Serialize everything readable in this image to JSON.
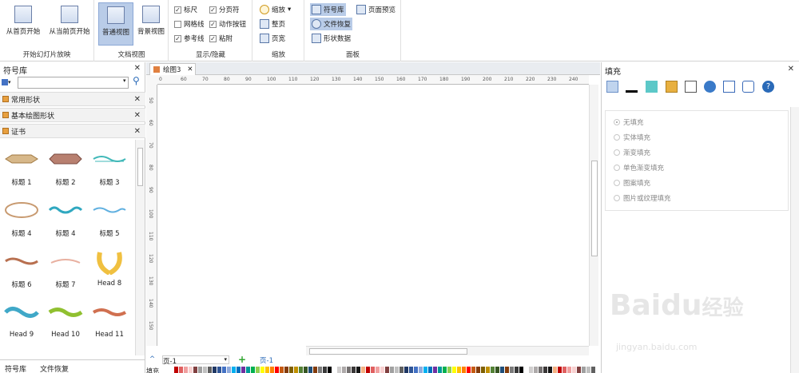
{
  "ribbon": {
    "groups": {
      "slideshow": {
        "label": "开始幻灯片放映",
        "from_first": "从首页开始",
        "from_current": "从当前页开始"
      },
      "docview": {
        "label": "文档视图",
        "normal": "普通视图",
        "background": "背景视图"
      },
      "showhide": {
        "label": "显示/隐藏",
        "ruler": "标尺",
        "pagebreak": "分页符",
        "grid": "网格线",
        "action": "动作按钮",
        "guides": "参考线",
        "glue": "粘附"
      },
      "zoom": {
        "label": "缩放",
        "zoom": "缩放",
        "fit_page": "整页",
        "page_width": "页宽"
      },
      "panels": {
        "label": "面板",
        "symbols": "符号库",
        "recovery": "文件恢复",
        "shape_data": "形状数据",
        "page_preview": "页面预览"
      }
    }
  },
  "left_panel": {
    "title": "符号库",
    "search_placeholder": "",
    "sections": [
      "常用形状",
      "基本绘图形状",
      "证书"
    ],
    "shapes": [
      {
        "label": "标题 1"
      },
      {
        "label": "标题 2"
      },
      {
        "label": "标题 3"
      },
      {
        "label": "标题 4"
      },
      {
        "label": "标题 4"
      },
      {
        "label": "标题 5"
      },
      {
        "label": "标题 6"
      },
      {
        "label": "标题 7"
      },
      {
        "label": "Head 8"
      },
      {
        "label": "Head 9"
      },
      {
        "label": "Head 10"
      },
      {
        "label": "Head 11"
      }
    ],
    "bottom_tabs": [
      "符号库",
      "文件恢复"
    ]
  },
  "canvas": {
    "tab_title": "绘图3",
    "ruler_h": [
      "0",
      "60",
      "70",
      "80",
      "90",
      "100",
      "110",
      "120",
      "130",
      "140",
      "150",
      "160",
      "170",
      "180",
      "190",
      "200",
      "210",
      "220",
      "230",
      "240"
    ],
    "ruler_v": [
      "50",
      "60",
      "70",
      "80",
      "90",
      "100",
      "110",
      "120",
      "130",
      "140",
      "150"
    ],
    "page_select": "页-1",
    "page_tab": "页-1",
    "fill_label": "填充"
  },
  "right_panel": {
    "title": "填充",
    "options": [
      "无填充",
      "实体填充",
      "渐变填充",
      "单色渐变填充",
      "图案填充",
      "图片或纹理填充"
    ],
    "selected_index": 0
  },
  "watermark": {
    "brand": "Bai",
    "brand2": "du",
    "cn": "经验",
    "url": "jingyan.baidu.com"
  },
  "colors": {
    "accent": "#2a6ab8",
    "ribbon_active": "#b9cce8",
    "palette": [
      "#c00000",
      "#e06060",
      "#f0a0a0",
      "#f8d0d0",
      "#804040",
      "#a0a0a0",
      "#c0c0c0",
      "#606060",
      "#203864",
      "#2f5597",
      "#4472c4",
      "#8faadc",
      "#00b0f0",
      "#0070c0",
      "#7030a0",
      "#009999",
      "#00b050",
      "#92d050",
      "#ffff00",
      "#ffc000",
      "#ff8000",
      "#ff0000",
      "#c55a11",
      "#843c0c",
      "#7f6000",
      "#bf9000",
      "#548235",
      "#375623",
      "#1f4e79",
      "#833c0b",
      "#7b7b7b",
      "#3a3a3a",
      "#000000",
      "#ffffff",
      "#d0cece",
      "#aeaaaa",
      "#757171",
      "#3b3838",
      "#161616",
      "#f4b183"
    ]
  }
}
